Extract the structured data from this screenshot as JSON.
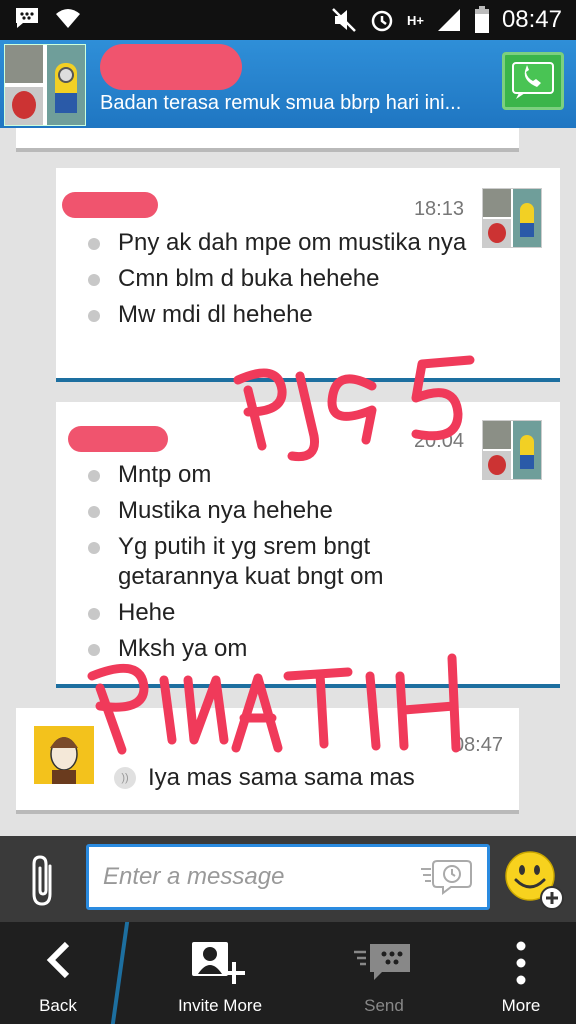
{
  "status_bar": {
    "time": "08:47",
    "network": "H+",
    "icons": [
      "bbm-icon",
      "wifi-icon",
      "mute-icon",
      "alarm-icon",
      "signal-icon",
      "battery-icon"
    ]
  },
  "header": {
    "status_message": "Badan terasa remuk smua bbrp hari ini...",
    "call_icon": "phone-icon"
  },
  "messages": [
    {
      "time": "18:13",
      "lines": [
        "Pny ak dah mpe om mustika nya",
        "Cmn blm d buka hehehe",
        "Mw mdi dl hehehe"
      ]
    },
    {
      "time": "20:04",
      "lines": [
        "Mntp om",
        "Mustika nya hehehe",
        "Yg putih it yg srem bngt getarannya kuat bngt om",
        "Hehe",
        "Mksh ya om"
      ]
    }
  ],
  "my_message": {
    "time": "08:47",
    "text": "Iya mas sama sama mas"
  },
  "annotations": {
    "scribble_1": "PJ95",
    "scribble_2": "PIN ATIH"
  },
  "input": {
    "placeholder": "Enter a message"
  },
  "actions": {
    "back": "Back",
    "invite": "Invite More",
    "send": "Send",
    "more": "More"
  },
  "colors": {
    "header_blue": "#1f76c2",
    "accent_blue": "#2a8be0",
    "redaction_pink": "#f0546e",
    "call_green": "#3bb54a"
  }
}
